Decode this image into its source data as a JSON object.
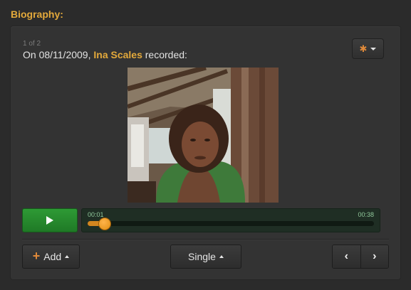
{
  "section": {
    "title": "Biography:"
  },
  "record": {
    "counter": "1 of 2",
    "prefix": "On 08/11/2009, ",
    "name": "Ina Scales",
    "suffix": " recorded:"
  },
  "settings": {
    "icon": "gear-icon"
  },
  "player": {
    "current_time": "00:01",
    "total_time": "00:38",
    "progress": 0.06,
    "play_icon": "play-icon"
  },
  "toolbar": {
    "add_label": "Add",
    "single_label": "Single",
    "prev_icon": "chevron-left-icon",
    "next_icon": "chevron-right-icon"
  },
  "colors": {
    "accent": "#e3a93b",
    "play_green": "#2e9a35",
    "timeline_bg": "#1f2e24",
    "knob": "#e08d12"
  }
}
